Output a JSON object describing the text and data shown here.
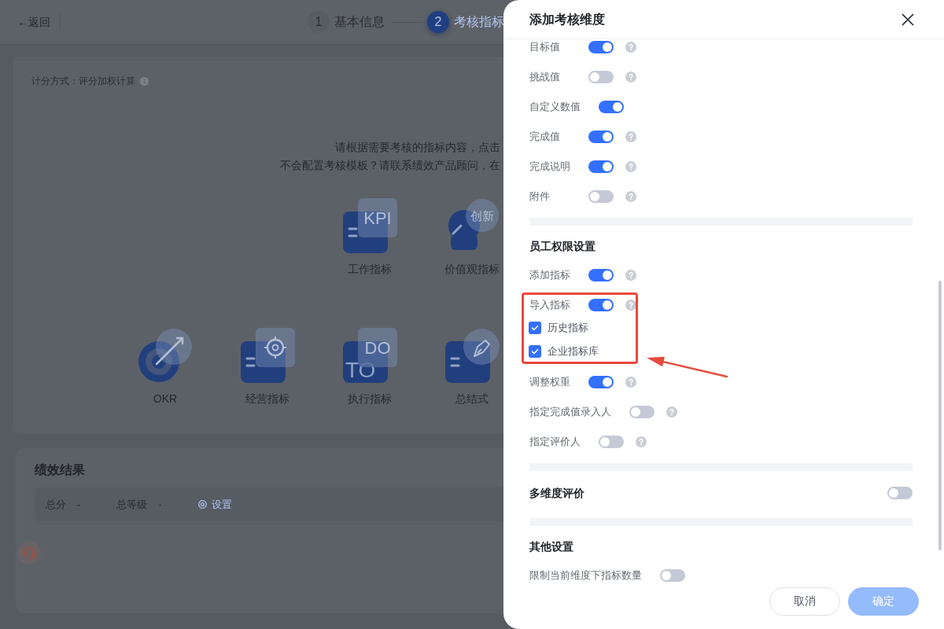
{
  "header": {
    "back": "←返回",
    "steps": [
      {
        "number": "1",
        "label": "基本信息",
        "selected": false
      },
      {
        "number": "2",
        "label": "考核指标",
        "selected": true
      }
    ]
  },
  "template_card": {
    "scoring": "计分方式：评分加权计算",
    "hint_lines": [
      "请根据需要考核的指标内容，点击",
      "不会配置考核模板？请联系绩效产品顾问，在"
    ],
    "rows": [
      [
        "",
        "",
        {
          "kind": "kpi",
          "label": "工作指标",
          "badge_text": "KPI"
        },
        {
          "kind": "values",
          "label": "价值观指标",
          "badge_text": "创新"
        }
      ],
      [
        {
          "kind": "okr",
          "label": "OKR"
        },
        {
          "kind": "business",
          "label": "经营指标"
        },
        {
          "kind": "execution",
          "label": "执行指标",
          "badge_text": "DO",
          "base_text": "TO"
        },
        {
          "kind": "summary",
          "label": "总结式"
        }
      ]
    ]
  },
  "result_card": {
    "title": "绩效结果",
    "fields": [
      {
        "label": "总分",
        "value": "-"
      },
      {
        "label": "总等级",
        "value": "-"
      }
    ],
    "link": "设置"
  },
  "drawer": {
    "title": "添加考核维度",
    "sections": [
      {
        "kind": "list",
        "items": [
          {
            "kind": "switch",
            "label": "目标值",
            "on": true,
            "help": true,
            "highlighted": false
          },
          {
            "kind": "switch",
            "label": "挑战值",
            "on": false,
            "help": true,
            "highlighted": false
          },
          {
            "kind": "switch",
            "label": "自定义数值",
            "on": true,
            "help": false,
            "highlighted": false
          },
          {
            "kind": "switch",
            "label": "完成值",
            "on": true,
            "help": true,
            "highlighted": false
          },
          {
            "kind": "switch",
            "label": "完成说明",
            "on": true,
            "help": true,
            "highlighted": false
          },
          {
            "kind": "switch",
            "label": "附件",
            "on": false,
            "help": true,
            "highlighted": false
          }
        ]
      },
      {
        "kind": "list",
        "title": "员工权限设置",
        "items": [
          {
            "kind": "switch",
            "label": "添加指标",
            "on": true,
            "help": true,
            "highlighted": false
          },
          {
            "kind": "switch",
            "label": "导入指标",
            "on": true,
            "help": true,
            "highlighted": true,
            "children": [
              {
                "kind": "checkbox",
                "label": "历史指标",
                "checked": true
              },
              {
                "kind": "checkbox",
                "label": "企业指标库",
                "checked": true
              }
            ]
          },
          {
            "kind": "switch",
            "label": "调整权重",
            "on": true,
            "help": true,
            "highlighted": false
          },
          {
            "kind": "switch",
            "label": "指定完成值录入人",
            "on": false,
            "help": true,
            "highlighted": false
          },
          {
            "kind": "switch",
            "label": "指定评价人",
            "on": false,
            "help": true,
            "highlighted": false
          }
        ]
      },
      {
        "kind": "inline",
        "title": "多维度评价",
        "on": false
      },
      {
        "kind": "list",
        "title": "其他设置",
        "items": [
          {
            "kind": "switch",
            "label": "限制当前维度下指标数量",
            "on": false,
            "help": false,
            "highlighted": false
          }
        ]
      }
    ],
    "buttons": [
      {
        "kind": "secondary",
        "label": "取消",
        "disabled": false
      },
      {
        "kind": "primary",
        "label": "确定",
        "disabled": true
      }
    ]
  }
}
